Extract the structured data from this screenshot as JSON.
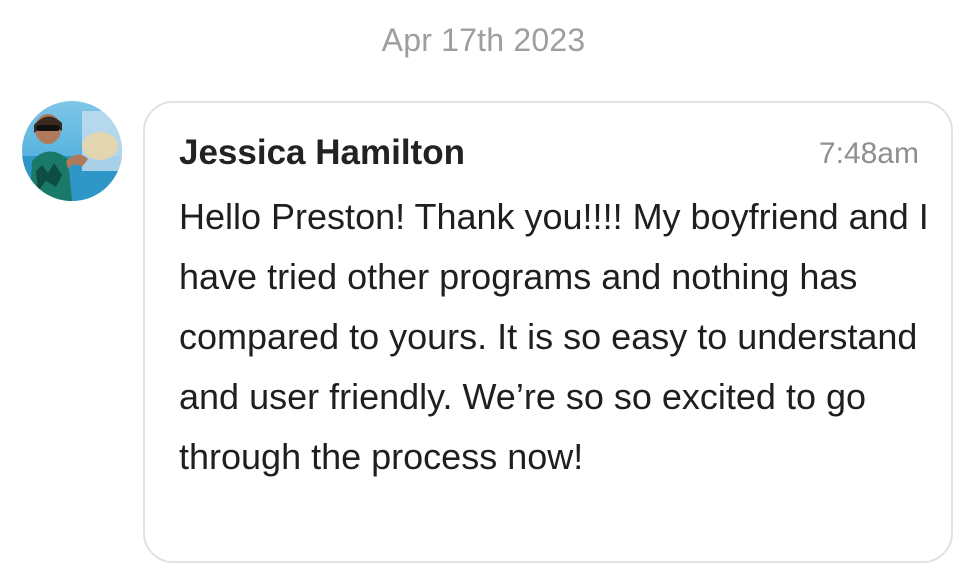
{
  "conversation": {
    "date_divider": "Apr 17th 2023"
  },
  "message": {
    "sender_name": "Jessica Hamilton",
    "timestamp": "7:48am",
    "text": "Hello Preston! Thank you!!!! My boyfriend and I have tried other programs and nothing has compared to yours. It is so easy to understand and user friendly. We’re so so excited to go through the process now!",
    "avatar": "user-avatar-photo"
  },
  "colors": {
    "bubble_border": "#e3e3e3",
    "muted_text": "#9e9e9e",
    "primary_text": "#1f1f1f"
  }
}
